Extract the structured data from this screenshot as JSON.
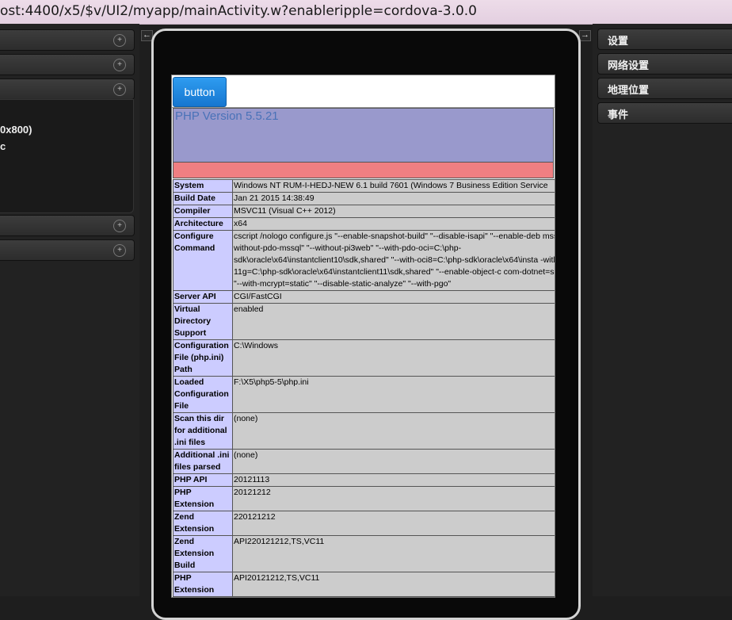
{
  "browser": {
    "url": "ost:4400/x5/$v/UI2/myapp/mainActivity.w?enableripple=cordova-3.0.0"
  },
  "left_panel": {
    "resolution_fragment": "0x800)",
    "text_fragment": "c",
    "collapse_toggle": "←",
    "plus_icon_glyph": "+"
  },
  "right_panel": {
    "expand_toggle": "→",
    "items": [
      "设置",
      "网络设置",
      "地理位置",
      "事件"
    ]
  },
  "app": {
    "button_label": "button",
    "php_version": "PHP Version 5.5.21",
    "rows": [
      {
        "key": "System",
        "value": "Windows NT RUM-I-HEDJ-NEW 6.1 build 7601 (Windows 7 Business Edition Service"
      },
      {
        "key": "Build Date",
        "value": "Jan 21 2015 14:38:49"
      },
      {
        "key": "Compiler",
        "value": "MSVC11 (Visual C++ 2012)"
      },
      {
        "key": "Architecture",
        "value": "x64"
      },
      {
        "key": "Configure Command",
        "value": "cscript /nologo configure.js \"--enable-snapshot-build\" \"--disable-isapi\" \"--enable-deb mssql\" \"--without-pdo-mssql\" \"--without-pi3web\" \"--with-pdo-oci=C:\\php-sdk\\oracle\\x64\\instantclient10\\sdk,shared\" \"--with-oci8=C:\\php-sdk\\oracle\\x64\\insta -with-oci8-11g=C:\\php-sdk\\oracle\\x64\\instantclient11\\sdk,shared\" \"--enable-object-c com-dotnet=shared\" \"--with-mcrypt=static\" \"--disable-static-analyze\" \"--with-pgo\""
      },
      {
        "key": "Server API",
        "value": "CGI/FastCGI"
      },
      {
        "key": "Virtual Directory Support",
        "value": "enabled"
      },
      {
        "key": "Configuration File (php.ini) Path",
        "value": "C:\\Windows"
      },
      {
        "key": "Loaded Configuration File",
        "value": "F:\\X5\\php5-5\\php.ini"
      },
      {
        "key": "Scan this dir for additional .ini files",
        "value": "(none)"
      },
      {
        "key": "Additional .ini files parsed",
        "value": "(none)"
      },
      {
        "key": "PHP API",
        "value": "20121113"
      },
      {
        "key": "PHP Extension",
        "value": "20121212"
      },
      {
        "key": "Zend Extension",
        "value": "220121212"
      },
      {
        "key": "Zend Extension Build",
        "value": "API220121212,TS,VC11"
      },
      {
        "key": "PHP Extension",
        "value": "API20121212,TS,VC11"
      }
    ]
  }
}
